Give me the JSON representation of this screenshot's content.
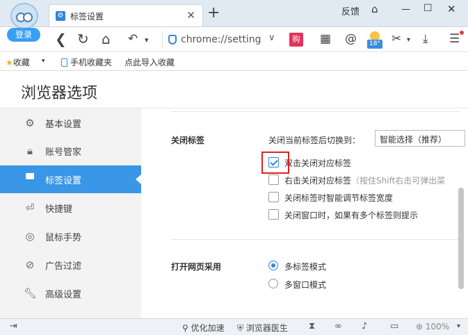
{
  "account": {
    "login_label": "登录"
  },
  "tab": {
    "title": "标签设置",
    "favicon": "gear-icon"
  },
  "window": {
    "feedback_label": "反馈"
  },
  "address": {
    "scheme": "chrome://",
    "path": "setting"
  },
  "toolbar": {
    "shopping_badge": "购",
    "weather_temp": "18°"
  },
  "bookmarks": {
    "favorites_label": "收藏",
    "mobile_label": "手机收藏夹",
    "import_label": "点此导入收藏"
  },
  "page": {
    "title": "浏览器选项"
  },
  "sidebar": {
    "items": [
      {
        "label": "基本设置",
        "icon": "gear-icon"
      },
      {
        "label": "账号管家",
        "icon": "lock-icon"
      },
      {
        "label": "标签设置",
        "icon": "tab-icon",
        "active": true
      },
      {
        "label": "快捷键",
        "icon": "keyboard-icon"
      },
      {
        "label": "鼠标手势",
        "icon": "mouse-icon"
      },
      {
        "label": "广告过滤",
        "icon": "block-icon"
      },
      {
        "label": "高级设置",
        "icon": "wrench-icon"
      }
    ]
  },
  "close_tab": {
    "section_title": "关闭标签",
    "switch_label": "关闭当前标签后切换到：",
    "switch_value": "智能选择（推荐）",
    "options": [
      {
        "label": "双击关闭对应标签",
        "checked": true,
        "hint": ""
      },
      {
        "label": "右击关闭对应标签",
        "checked": false,
        "hint": "（按住Shift右击可弹出菜"
      },
      {
        "label": "关闭标签时智能调节标签宽度",
        "checked": false,
        "hint": ""
      },
      {
        "label": "关闭窗口时，如果有多个标签则提示",
        "checked": false,
        "hint": ""
      }
    ]
  },
  "open_page": {
    "section_title": "打开网页采用",
    "options": [
      {
        "label": "多标签模式",
        "selected": true
      },
      {
        "label": "多窗口模式",
        "selected": false
      }
    ]
  },
  "statusbar": {
    "speedup_label": "优化加速",
    "doctor_label": "浏览器医生",
    "zoom_label": "100%"
  }
}
